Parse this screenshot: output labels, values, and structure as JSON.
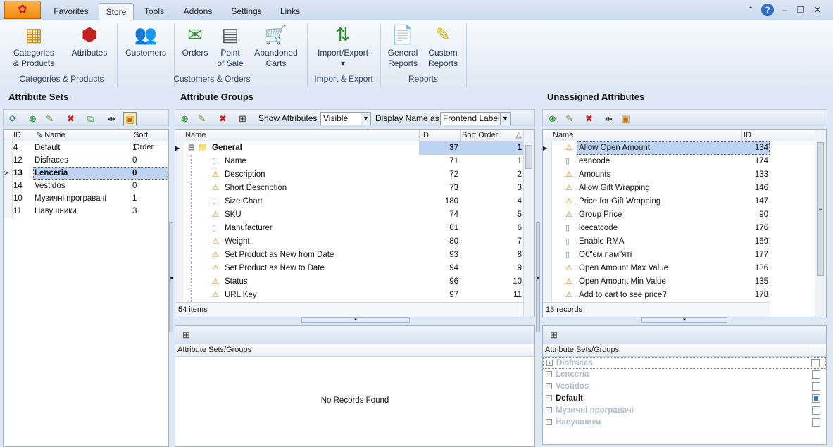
{
  "menu_tabs": [
    "Favorites",
    "Store",
    "Tools",
    "Addons",
    "Settings",
    "Links"
  ],
  "active_tab": "Store",
  "ribbon": {
    "buttons": [
      {
        "label1": "Categories",
        "label2": "& Products",
        "icon": "boxes-icon"
      },
      {
        "label1": "Attributes",
        "label2": "",
        "icon": "molecule-icon"
      },
      {
        "label1": "Customers",
        "label2": "",
        "icon": "people-icon"
      },
      {
        "label1": "Orders",
        "label2": "",
        "icon": "envelope-icon"
      },
      {
        "label1": "Point",
        "label2": "of Sale",
        "icon": "cash-register-icon"
      },
      {
        "label1": "Abandoned",
        "label2": "Carts",
        "icon": "cart-icon"
      },
      {
        "label1": "Import/Export",
        "label2": "▾",
        "icon": "arrows-icon"
      },
      {
        "label1": "General",
        "label2": "Reports",
        "icon": "notepad-icon"
      },
      {
        "label1": "Custom",
        "label2": "Reports",
        "icon": "notepad-pen-icon"
      }
    ],
    "groups": [
      "Categories & Products",
      "Customers & Orders",
      "Import & Export",
      "Reports"
    ]
  },
  "attribute_sets": {
    "title": "Attribute Sets",
    "columns": [
      "ID",
      "Name",
      "Sort Order"
    ],
    "rows": [
      {
        "id": "4",
        "name": "Default",
        "sort": "1"
      },
      {
        "id": "12",
        "name": "Disfraces",
        "sort": "0"
      },
      {
        "id": "13",
        "name": "Lenceria",
        "sort": "0"
      },
      {
        "id": "14",
        "name": "Vestidos",
        "sort": "0"
      },
      {
        "id": "10",
        "name": "Музичні програвачі",
        "sort": "1"
      },
      {
        "id": "11",
        "name": "Навушники",
        "sort": "3"
      }
    ],
    "selected_index": 2
  },
  "attribute_groups": {
    "title": "Attribute Groups",
    "show_attributes_label": "Show Attributes",
    "show_attributes_value": "Visible",
    "display_name_label": "Display Name as",
    "display_name_value": "Frontend Label",
    "columns": [
      "Name",
      "ID",
      "Sort Order"
    ],
    "group": {
      "name": "General",
      "id": "37",
      "sort": "1"
    },
    "rows": [
      {
        "name": "Name",
        "id": "71",
        "sort": "1",
        "warn": false
      },
      {
        "name": "Description",
        "id": "72",
        "sort": "2",
        "warn": true
      },
      {
        "name": "Short Description",
        "id": "73",
        "sort": "3",
        "warn": true
      },
      {
        "name": "Size Chart",
        "id": "180",
        "sort": "4",
        "warn": false
      },
      {
        "name": "SKU",
        "id": "74",
        "sort": "5",
        "warn": true
      },
      {
        "name": "Manufacturer",
        "id": "81",
        "sort": "6",
        "warn": false
      },
      {
        "name": "Weight",
        "id": "80",
        "sort": "7",
        "warn": true
      },
      {
        "name": "Set Product as New from Date",
        "id": "93",
        "sort": "8",
        "warn": true
      },
      {
        "name": "Set Product as New to Date",
        "id": "94",
        "sort": "9",
        "warn": true
      },
      {
        "name": "Status",
        "id": "96",
        "sort": "10",
        "warn": true
      },
      {
        "name": "URL Key",
        "id": "97",
        "sort": "11",
        "warn": true
      }
    ],
    "footer": "54 items"
  },
  "unassigned": {
    "title": "Unassigned Attributes",
    "columns": [
      "Name",
      "ID"
    ],
    "rows": [
      {
        "name": "Allow Open Amount",
        "id": "134",
        "warn": true
      },
      {
        "name": "eancode",
        "id": "174",
        "warn": false
      },
      {
        "name": "Amounts",
        "id": "133",
        "warn": true
      },
      {
        "name": "Allow Gift Wrapping",
        "id": "146",
        "warn": true
      },
      {
        "name": "Price for Gift Wrapping",
        "id": "147",
        "warn": true
      },
      {
        "name": "Group Price",
        "id": "90",
        "warn": true
      },
      {
        "name": "icecatcode",
        "id": "176",
        "warn": false
      },
      {
        "name": "Enable RMA",
        "id": "169",
        "warn": false
      },
      {
        "name": "Об\"єм пам\"яті",
        "id": "177",
        "warn": false
      },
      {
        "name": "Open Amount Max Value",
        "id": "136",
        "warn": true
      },
      {
        "name": "Open Amount Min Value",
        "id": "135",
        "warn": true
      },
      {
        "name": "Add to cart to see price?",
        "id": "178",
        "warn": true
      }
    ],
    "footer": "13 records"
  },
  "sets_groups_left": {
    "header": "Attribute Sets/Groups",
    "empty": "No Records Found"
  },
  "sets_groups_right": {
    "header": "Attribute Sets/Groups",
    "items": [
      {
        "name": "Disfraces",
        "bold": false,
        "checked": false
      },
      {
        "name": "Lenceria",
        "bold": false,
        "checked": false
      },
      {
        "name": "Vestidos",
        "bold": false,
        "checked": false
      },
      {
        "name": "Default",
        "bold": true,
        "checked": true
      },
      {
        "name": "Музичні програвачі",
        "bold": false,
        "checked": false
      },
      {
        "name": "Навушники",
        "bold": false,
        "checked": false
      }
    ]
  },
  "colors": {
    "accent": "#bcd3f1",
    "warning": "#e0b000",
    "delete": "#d42020",
    "add": "#1c9a2c"
  }
}
